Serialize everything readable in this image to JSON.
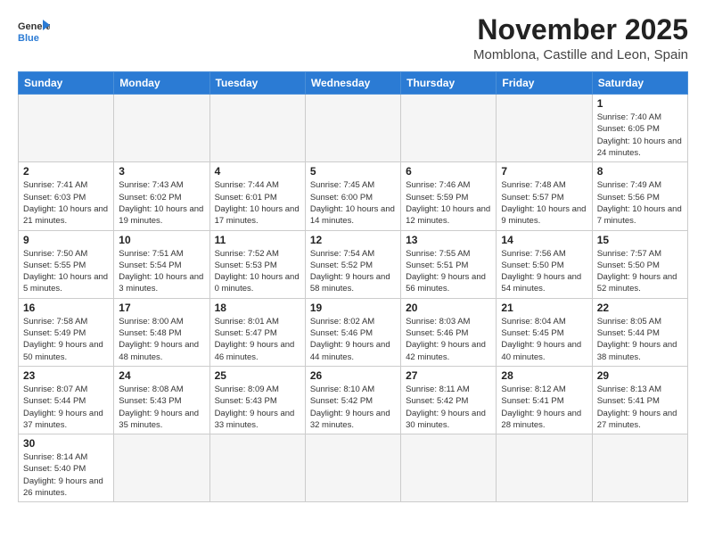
{
  "header": {
    "logo_general": "General",
    "logo_blue": "Blue",
    "month_title": "November 2025",
    "location": "Momblona, Castille and Leon, Spain"
  },
  "days_of_week": [
    "Sunday",
    "Monday",
    "Tuesday",
    "Wednesday",
    "Thursday",
    "Friday",
    "Saturday"
  ],
  "weeks": [
    [
      {
        "day": "",
        "info": ""
      },
      {
        "day": "",
        "info": ""
      },
      {
        "day": "",
        "info": ""
      },
      {
        "day": "",
        "info": ""
      },
      {
        "day": "",
        "info": ""
      },
      {
        "day": "",
        "info": ""
      },
      {
        "day": "1",
        "info": "Sunrise: 7:40 AM\nSunset: 6:05 PM\nDaylight: 10 hours and 24 minutes."
      }
    ],
    [
      {
        "day": "2",
        "info": "Sunrise: 7:41 AM\nSunset: 6:03 PM\nDaylight: 10 hours and 21 minutes."
      },
      {
        "day": "3",
        "info": "Sunrise: 7:43 AM\nSunset: 6:02 PM\nDaylight: 10 hours and 19 minutes."
      },
      {
        "day": "4",
        "info": "Sunrise: 7:44 AM\nSunset: 6:01 PM\nDaylight: 10 hours and 17 minutes."
      },
      {
        "day": "5",
        "info": "Sunrise: 7:45 AM\nSunset: 6:00 PM\nDaylight: 10 hours and 14 minutes."
      },
      {
        "day": "6",
        "info": "Sunrise: 7:46 AM\nSunset: 5:59 PM\nDaylight: 10 hours and 12 minutes."
      },
      {
        "day": "7",
        "info": "Sunrise: 7:48 AM\nSunset: 5:57 PM\nDaylight: 10 hours and 9 minutes."
      },
      {
        "day": "8",
        "info": "Sunrise: 7:49 AM\nSunset: 5:56 PM\nDaylight: 10 hours and 7 minutes."
      }
    ],
    [
      {
        "day": "9",
        "info": "Sunrise: 7:50 AM\nSunset: 5:55 PM\nDaylight: 10 hours and 5 minutes."
      },
      {
        "day": "10",
        "info": "Sunrise: 7:51 AM\nSunset: 5:54 PM\nDaylight: 10 hours and 3 minutes."
      },
      {
        "day": "11",
        "info": "Sunrise: 7:52 AM\nSunset: 5:53 PM\nDaylight: 10 hours and 0 minutes."
      },
      {
        "day": "12",
        "info": "Sunrise: 7:54 AM\nSunset: 5:52 PM\nDaylight: 9 hours and 58 minutes."
      },
      {
        "day": "13",
        "info": "Sunrise: 7:55 AM\nSunset: 5:51 PM\nDaylight: 9 hours and 56 minutes."
      },
      {
        "day": "14",
        "info": "Sunrise: 7:56 AM\nSunset: 5:50 PM\nDaylight: 9 hours and 54 minutes."
      },
      {
        "day": "15",
        "info": "Sunrise: 7:57 AM\nSunset: 5:50 PM\nDaylight: 9 hours and 52 minutes."
      }
    ],
    [
      {
        "day": "16",
        "info": "Sunrise: 7:58 AM\nSunset: 5:49 PM\nDaylight: 9 hours and 50 minutes."
      },
      {
        "day": "17",
        "info": "Sunrise: 8:00 AM\nSunset: 5:48 PM\nDaylight: 9 hours and 48 minutes."
      },
      {
        "day": "18",
        "info": "Sunrise: 8:01 AM\nSunset: 5:47 PM\nDaylight: 9 hours and 46 minutes."
      },
      {
        "day": "19",
        "info": "Sunrise: 8:02 AM\nSunset: 5:46 PM\nDaylight: 9 hours and 44 minutes."
      },
      {
        "day": "20",
        "info": "Sunrise: 8:03 AM\nSunset: 5:46 PM\nDaylight: 9 hours and 42 minutes."
      },
      {
        "day": "21",
        "info": "Sunrise: 8:04 AM\nSunset: 5:45 PM\nDaylight: 9 hours and 40 minutes."
      },
      {
        "day": "22",
        "info": "Sunrise: 8:05 AM\nSunset: 5:44 PM\nDaylight: 9 hours and 38 minutes."
      }
    ],
    [
      {
        "day": "23",
        "info": "Sunrise: 8:07 AM\nSunset: 5:44 PM\nDaylight: 9 hours and 37 minutes."
      },
      {
        "day": "24",
        "info": "Sunrise: 8:08 AM\nSunset: 5:43 PM\nDaylight: 9 hours and 35 minutes."
      },
      {
        "day": "25",
        "info": "Sunrise: 8:09 AM\nSunset: 5:43 PM\nDaylight: 9 hours and 33 minutes."
      },
      {
        "day": "26",
        "info": "Sunrise: 8:10 AM\nSunset: 5:42 PM\nDaylight: 9 hours and 32 minutes."
      },
      {
        "day": "27",
        "info": "Sunrise: 8:11 AM\nSunset: 5:42 PM\nDaylight: 9 hours and 30 minutes."
      },
      {
        "day": "28",
        "info": "Sunrise: 8:12 AM\nSunset: 5:41 PM\nDaylight: 9 hours and 28 minutes."
      },
      {
        "day": "29",
        "info": "Sunrise: 8:13 AM\nSunset: 5:41 PM\nDaylight: 9 hours and 27 minutes."
      }
    ],
    [
      {
        "day": "30",
        "info": "Sunrise: 8:14 AM\nSunset: 5:40 PM\nDaylight: 9 hours and 26 minutes."
      },
      {
        "day": "",
        "info": ""
      },
      {
        "day": "",
        "info": ""
      },
      {
        "day": "",
        "info": ""
      },
      {
        "day": "",
        "info": ""
      },
      {
        "day": "",
        "info": ""
      },
      {
        "day": "",
        "info": ""
      }
    ]
  ]
}
